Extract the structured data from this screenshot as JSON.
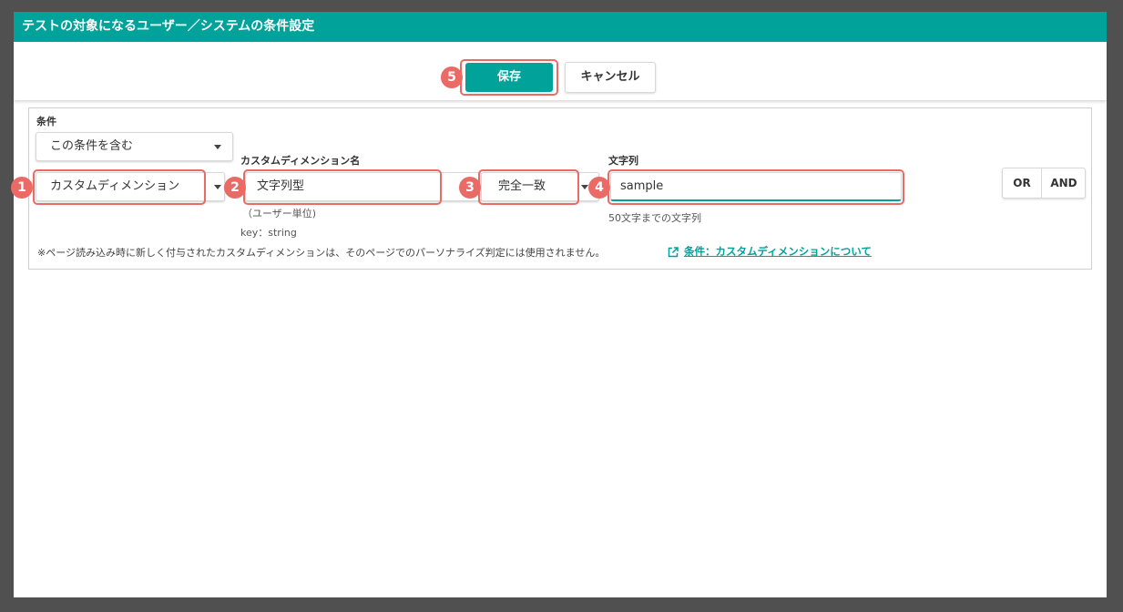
{
  "dialog": {
    "title": "テストの対象になるユーザー／システムの条件設定"
  },
  "toolbar": {
    "save_label": "保存",
    "cancel_label": "キャンセル"
  },
  "annotations": {
    "badge1": "1",
    "badge2": "2",
    "badge3": "3",
    "badge4": "4",
    "badge5": "5",
    "highlight_color": "#ea6a66"
  },
  "condition": {
    "label": "条件",
    "include_select": "この条件を含む",
    "type_select": "カスタムディメンション",
    "dimension_label": "カスタムディメンション名",
    "dimension_select": "文字列型",
    "dimension_scope": "（ユーザー単位)",
    "dimension_key": "key：string",
    "match_select": "完全一致",
    "string_label": "文字列",
    "string_value": "sample",
    "string_hint": "50文字までの文字列",
    "note": "※ページ読み込み時に新しく付与されたカスタムディメンションは、そのページでのパーソナライズ判定には使用されません。",
    "help_link": "条件：カスタムディメンションについて",
    "or_label": "OR",
    "and_label": "AND"
  },
  "colors": {
    "accent": "#00a29a",
    "backdrop": "#505050"
  }
}
